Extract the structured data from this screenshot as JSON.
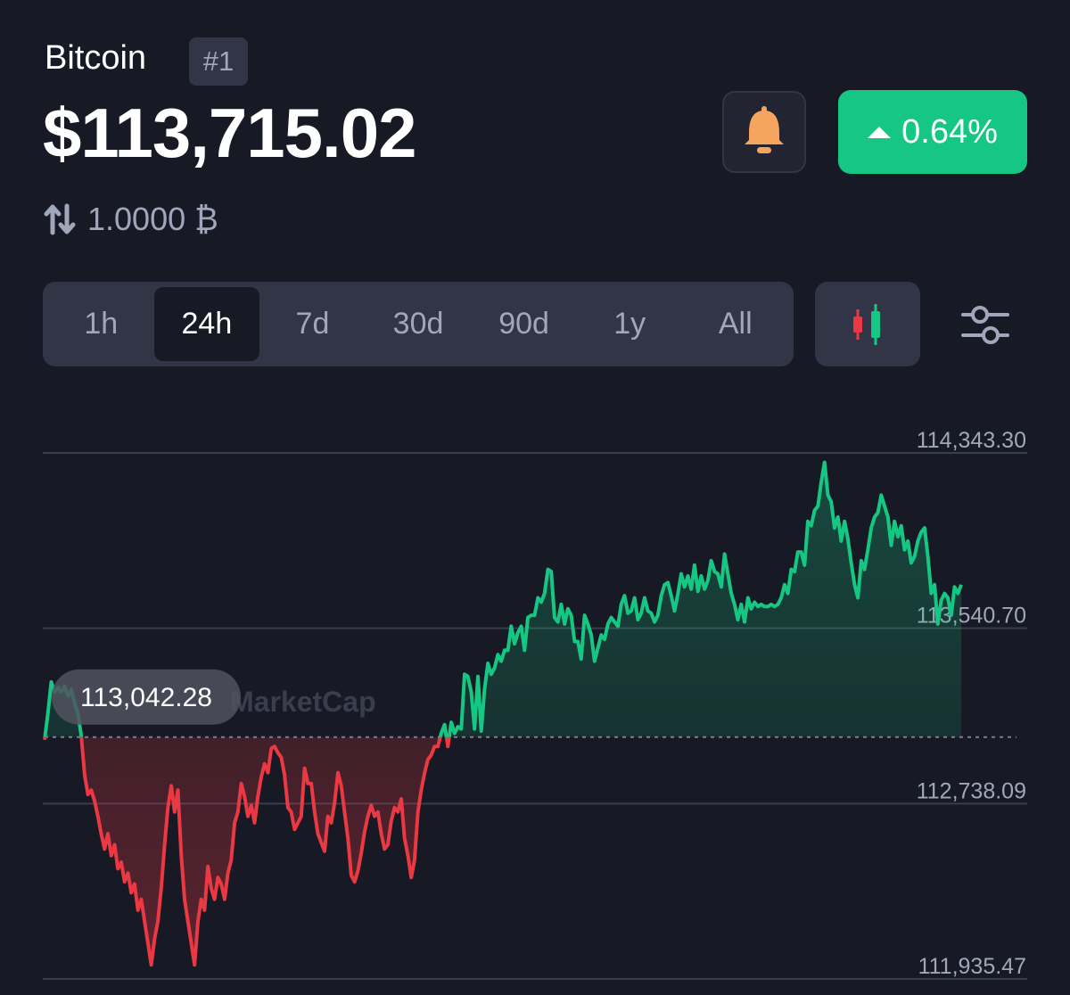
{
  "header": {
    "coin_name": "Bitcoin",
    "rank": "#1",
    "price": "$113,715.02",
    "change_percent": "0.64%",
    "conversion": "1.0000 ₿",
    "bell_icon": "bell-icon",
    "change_icon": "caret-up-icon",
    "convert_icon": "swap-vertical-icon"
  },
  "tabs": [
    {
      "label": "1h",
      "active": false
    },
    {
      "label": "24h",
      "active": true
    },
    {
      "label": "7d",
      "active": false
    },
    {
      "label": "30d",
      "active": false
    },
    {
      "label": "90d",
      "active": false
    },
    {
      "label": "1y",
      "active": false
    },
    {
      "label": "All",
      "active": false
    }
  ],
  "toolbar": {
    "chart_type_icon": "candlestick-icon",
    "settings_icon": "sliders-icon"
  },
  "watermark": "MarketCap",
  "colors": {
    "up": "#16c784",
    "down": "#ea3943",
    "background": "#171924",
    "panel": "#323546",
    "muted": "#a1a7bb",
    "bell": "#f6a55e"
  },
  "chart_data": {
    "type": "line",
    "y_ticks": [
      "114,343.30",
      "113,540.70",
      "112,738.09",
      "111,935.47"
    ],
    "y_tick_values": [
      114343.3,
      113540.7,
      112738.09,
      111935.47
    ],
    "ylim": [
      111935.47,
      114343.3
    ],
    "baseline_label": "113,042.28",
    "baseline": 113042.28,
    "grid": true,
    "x": [
      0,
      1,
      2,
      3,
      4,
      5,
      6,
      7,
      8,
      9,
      10,
      11,
      12,
      13,
      14,
      15,
      16,
      17,
      18,
      19,
      20,
      21,
      22,
      23,
      24,
      25,
      26,
      27,
      28,
      29,
      30,
      31,
      32,
      33,
      34,
      35,
      36,
      37,
      38,
      39,
      40,
      41,
      42,
      43,
      44,
      45,
      46,
      47,
      48,
      49,
      50,
      51,
      52,
      53,
      54,
      55,
      56,
      57,
      58,
      59,
      60,
      61,
      62,
      63,
      64,
      65,
      66,
      67,
      68,
      69,
      70,
      71,
      72,
      73,
      74,
      75,
      76,
      77,
      78,
      79,
      80,
      81,
      82,
      83,
      84,
      85,
      86,
      87,
      88,
      89,
      90,
      91,
      92,
      93,
      94,
      95,
      96,
      97,
      98,
      99,
      100,
      101,
      102,
      103,
      104,
      105,
      106,
      107,
      108,
      109,
      110,
      111,
      112,
      113,
      114,
      115,
      116,
      117,
      118,
      119,
      120,
      121,
      122,
      123,
      124,
      125,
      126,
      127,
      128,
      129,
      130,
      131,
      132,
      133,
      134,
      135,
      136,
      137,
      138,
      139,
      140,
      141,
      142,
      143,
      144,
      145,
      146,
      147,
      148,
      149,
      150,
      151,
      152,
      153,
      154,
      155,
      156,
      157,
      158,
      159,
      160,
      161,
      162,
      163,
      164,
      165,
      166,
      167,
      168,
      169,
      170,
      171,
      172,
      173,
      174,
      175,
      176,
      177,
      178,
      179,
      180,
      181,
      182,
      183,
      184,
      185,
      186,
      187,
      188,
      189,
      190,
      191,
      192,
      193,
      194,
      195,
      196,
      197,
      198,
      199,
      200,
      201,
      202,
      203,
      204,
      205,
      206,
      207,
      208,
      209,
      210,
      211,
      212,
      213,
      214,
      215,
      216,
      217,
      218,
      219,
      220,
      221,
      222,
      223,
      224,
      225,
      226,
      227,
      228,
      229,
      230,
      231,
      232,
      233,
      234,
      235,
      236,
      237,
      238,
      239,
      240,
      241,
      242,
      243,
      244,
      245,
      246,
      247,
      248,
      249,
      250,
      251,
      252,
      253,
      254,
      255
    ],
    "values": [
      113030,
      113150,
      113295,
      113250,
      113270,
      113250,
      113275,
      113230,
      113260,
      113200,
      113150,
      113050,
      112870,
      112780,
      112800,
      112750,
      112680,
      112600,
      112530,
      112600,
      112500,
      112550,
      112440,
      112470,
      112380,
      112420,
      112330,
      112370,
      112250,
      112300,
      112200,
      112100,
      112000,
      112120,
      112200,
      112350,
      112550,
      112720,
      112820,
      112700,
      112800,
      112500,
      112300,
      112200,
      112100,
      112000,
      112200,
      112300,
      112250,
      112450,
      112350,
      112300,
      112400,
      112370,
      112300,
      112420,
      112480,
      112650,
      112700,
      112830,
      112770,
      112680,
      112730,
      112650,
      112770,
      112860,
      112920,
      112880,
      112990,
      113000,
      112970,
      112950,
      112870,
      112720,
      112700,
      112620,
      112650,
      112680,
      112900,
      112830,
      112830,
      112700,
      112600,
      112560,
      112520,
      112680,
      112650,
      112740,
      112880,
      112820,
      112700,
      112580,
      112410,
      112380,
      112430,
      112510,
      112610,
      112680,
      112730,
      112680,
      112700,
      112600,
      112530,
      112550,
      112660,
      112720,
      112700,
      112760,
      112580,
      112500,
      112400,
      112480,
      112700,
      112800,
      112880,
      112940,
      112960,
      113000,
      113000,
      113060,
      113100,
      113000,
      113110,
      113060,
      113090,
      113080,
      113330,
      113320,
      113250,
      113080,
      113320,
      113070,
      113260,
      113380,
      113330,
      113360,
      113420,
      113390,
      113440,
      113440,
      113550,
      113470,
      113520,
      113550,
      113440,
      113590,
      113600,
      113600,
      113680,
      113660,
      113700,
      113810,
      113800,
      113590,
      113570,
      113650,
      113560,
      113630,
      113600,
      113480,
      113480,
      113400,
      113600,
      113560,
      113510,
      113390,
      113450,
      113510,
      113490,
      113560,
      113590,
      113570,
      113550,
      113650,
      113690,
      113610,
      113620,
      113680,
      113580,
      113610,
      113680,
      113620,
      113610,
      113570,
      113600,
      113690,
      113740,
      113750,
      113690,
      113620,
      113700,
      113790,
      113730,
      113780,
      113720,
      113830,
      113710,
      113780,
      113720,
      113760,
      113850,
      113800,
      113790,
      113730,
      113880,
      113790,
      113700,
      113650,
      113580,
      113650,
      113570,
      113680,
      113630,
      113660,
      113640,
      113650,
      113640,
      113640,
      113650,
      113640,
      113650,
      113680,
      113740,
      113700,
      113810,
      113800,
      113890,
      113890,
      113830,
      114030,
      114010,
      114080,
      114100,
      114210,
      114300,
      114150,
      114120,
      114000,
      114050,
      113940,
      114030,
      113950,
      113840,
      113740,
      113680,
      113850,
      113810,
      113900,
      114000,
      114050,
      114070,
      114150,
      114100,
      114050,
      113920,
      114030,
      113960,
      114010,
      113900,
      113940,
      113840,
      113870,
      113940,
      113980,
      114000,
      113870,
      113700,
      113740,
      113560,
      113670,
      113700,
      113680,
      113600,
      113730,
      113700,
      113740
    ]
  }
}
